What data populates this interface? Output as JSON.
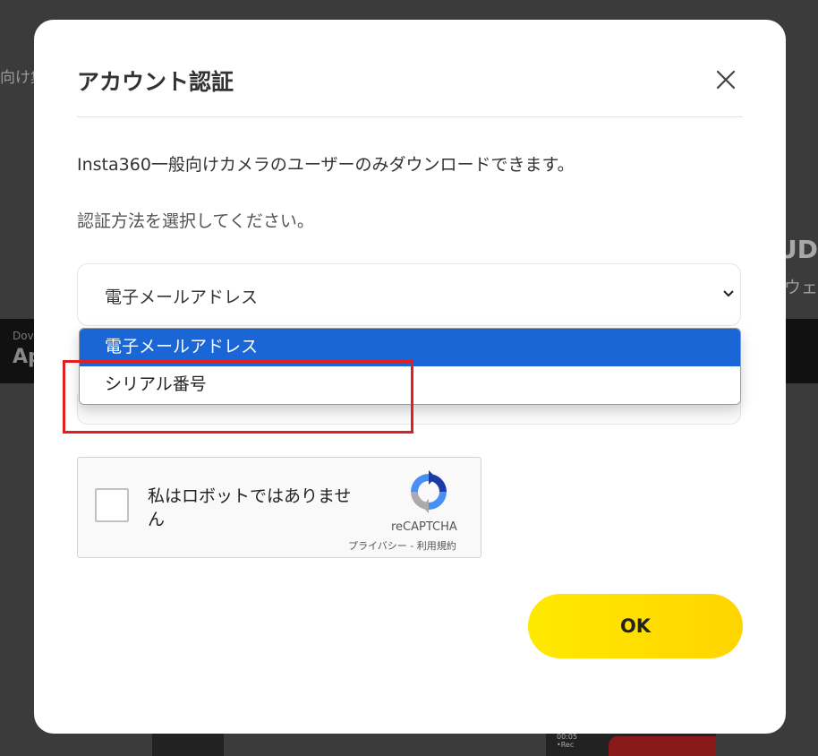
{
  "background": {
    "left_fragment": "向け集",
    "right_heading_fragment": "UD",
    "right_sub_fragment": "ウェ",
    "band_small": "Dov",
    "band_big": "Ap",
    "device_text": "00:05\n•Rec"
  },
  "modal": {
    "title": "アカウント認証",
    "description": "Insta360一般向けカメラのユーザーのみダウンロードできます。",
    "instruction": "認証方法を選択してください。",
    "select": {
      "value": "電子メールアドレス",
      "options": [
        "電子メールアドレス",
        "シリアル番号"
      ],
      "selected_index": 0
    },
    "recaptcha": {
      "label": "私はロボットではありません",
      "brand": "reCAPTCHA",
      "links": "プライバシー - 利用規約"
    },
    "ok_label": "OK"
  },
  "colors": {
    "accent_yellow": "#ffe500",
    "selected_option_blue": "#1a66d6",
    "highlight_red": "#e02020"
  }
}
